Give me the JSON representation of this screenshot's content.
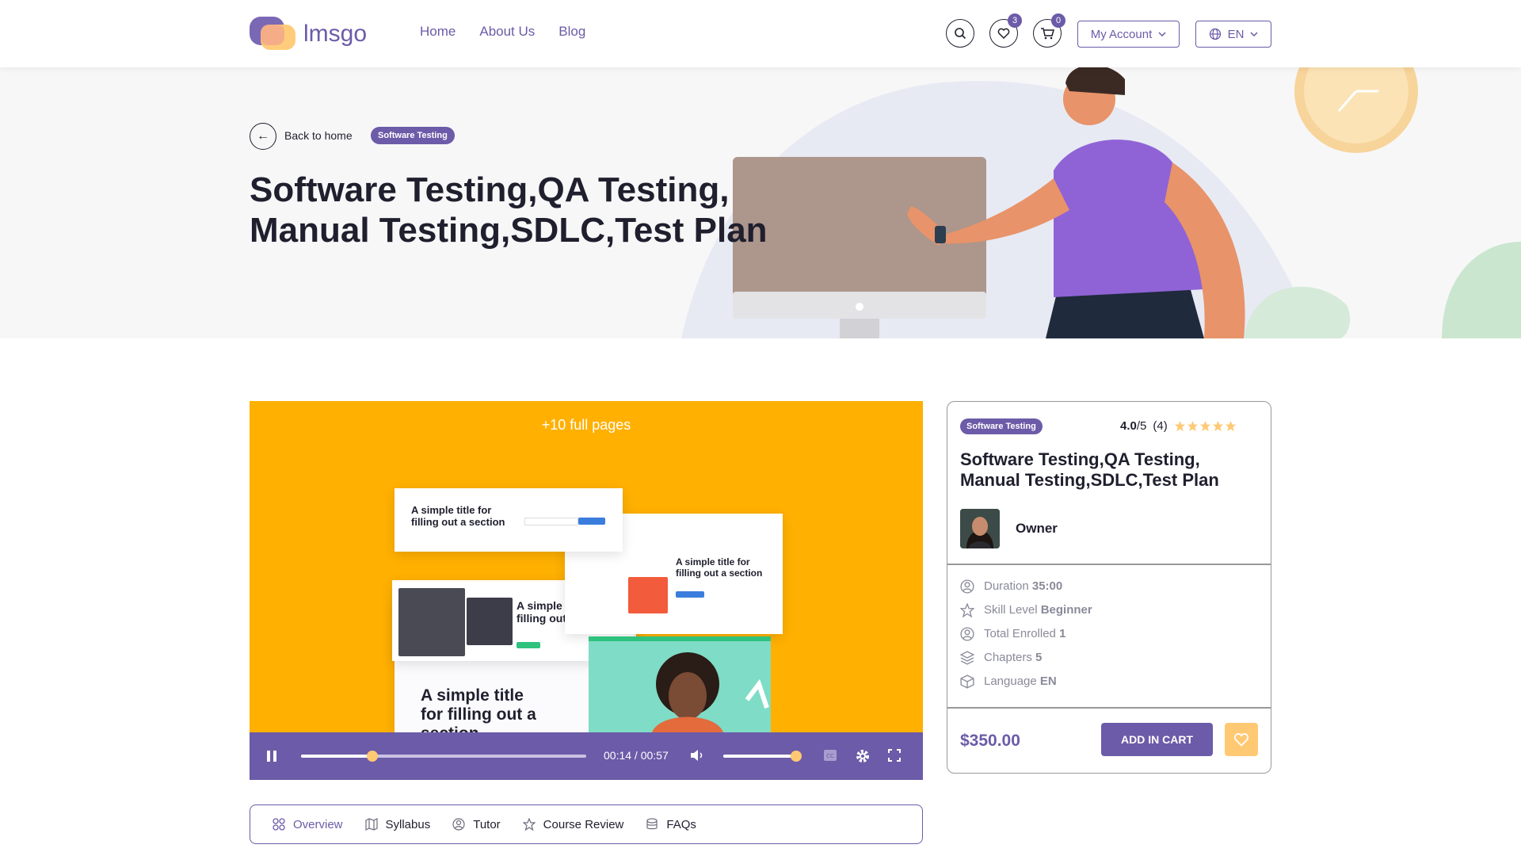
{
  "header": {
    "logo_text": "lmsgo",
    "nav": [
      "Home",
      "About Us",
      "Blog"
    ],
    "wishlist_count": "3",
    "cart_count": "0",
    "account_label": "My Account",
    "language_label": "EN"
  },
  "hero": {
    "back_label": "Back to home",
    "category": "Software Testing",
    "title": "Software Testing,QA Testing, Manual Testing,SDLC,Test Plan"
  },
  "video": {
    "top_text": "+10 full pages",
    "mock_title": "A simple title for filling out a section",
    "mock_title_short": "A simple tit filling out a",
    "mock_title_large": "A simple title for filling out a section",
    "time_display": "00:14 / 00:57",
    "progress_fraction": 0.25,
    "volume_fraction": 1.0
  },
  "tabs": [
    {
      "label": "Overview",
      "icon": "grid-icon",
      "active": true
    },
    {
      "label": "Syllabus",
      "icon": "map-icon",
      "active": false
    },
    {
      "label": "Tutor",
      "icon": "user-icon",
      "active": false
    },
    {
      "label": "Course Review",
      "icon": "star-icon",
      "active": false
    },
    {
      "label": "FAQs",
      "icon": "database-icon",
      "active": false
    }
  ],
  "card": {
    "category": "Software Testing",
    "rating_value": "4.0",
    "rating_scale": "/5",
    "rating_count": "(4)",
    "stars": 5,
    "title": "Software Testing,QA Testing, Manual Testing,SDLC,Test Plan",
    "owner_label": "Owner",
    "meta": [
      {
        "label": "Duration",
        "value": "35:00",
        "icon": "clock-user-icon"
      },
      {
        "label": "Skill Level",
        "value": "Beginner",
        "icon": "star-icon"
      },
      {
        "label": "Total Enrolled",
        "value": "1",
        "icon": "user-icon"
      },
      {
        "label": "Chapters",
        "value": "5",
        "icon": "layers-icon"
      },
      {
        "label": "Language",
        "value": "EN",
        "icon": "box-icon"
      }
    ],
    "price": "$350.00",
    "add_to_cart": "ADD IN CART"
  },
  "colors": {
    "brand": "#6c5ba8",
    "video_bg": "#ffb000",
    "star": "#ffc974"
  }
}
